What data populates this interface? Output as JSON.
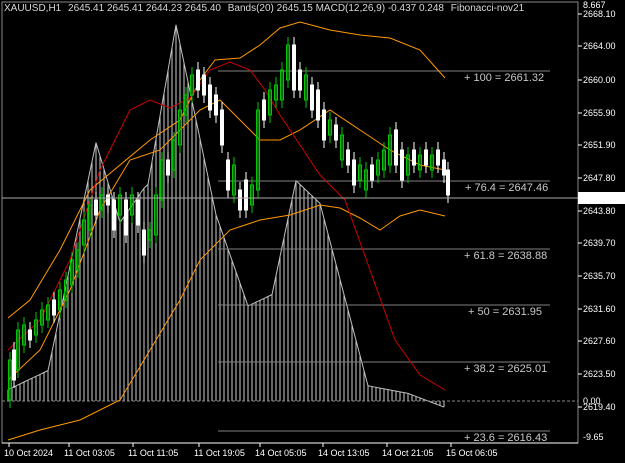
{
  "header": {
    "symbol": "XAUUSD,H1",
    "ohlc": "2645.41 2645.41 2644.23 2645.40",
    "indicator": "Bands(20) 2645.15 MACD(12,26,9) -0.437 0.248",
    "fibonacci": "Fibonacci-nov21"
  },
  "colors": {
    "background": "#000000",
    "candle_up": "#00c800",
    "candle_down": "#ffffff",
    "bands": "#ff9900",
    "ma": "#cc0000",
    "macd_line": "#c0c0c0",
    "fib_lines": "#808080",
    "axis_text": "#ffffff"
  },
  "price_axis": {
    "ticks": [
      "2668.10",
      "2664.00",
      "2660.00",
      "2655.90",
      "2651.90",
      "2647.80",
      "2643.80",
      "2639.70",
      "2635.70",
      "2631.60",
      "2627.60",
      "2623.50",
      "2619.40"
    ],
    "current_price": "2645.40",
    "top_label": "8.667",
    "macd_zero": "0.00",
    "bottom_label": "-9.65"
  },
  "time_axis": {
    "labels": [
      "10 Oct 2024",
      "11 Oct 03:05",
      "11 Oct 11:05",
      "11 Oct 19:05",
      "14 Oct 05:05",
      "14 Oct 13:05",
      "14 Oct 21:05",
      "15 Oct 06:05"
    ]
  },
  "fibonacci_levels": [
    {
      "label": "+ 100  = 2661.32"
    },
    {
      "label": "+ 76.4  = 2647.46"
    },
    {
      "label": "+ 61.8  = 2638.88"
    },
    {
      "label": "+ 50  = 2631.95"
    },
    {
      "label": "+ 38.2  = 2625.01"
    },
    {
      "label": "+ 23.6  = 2616.43"
    }
  ]
}
